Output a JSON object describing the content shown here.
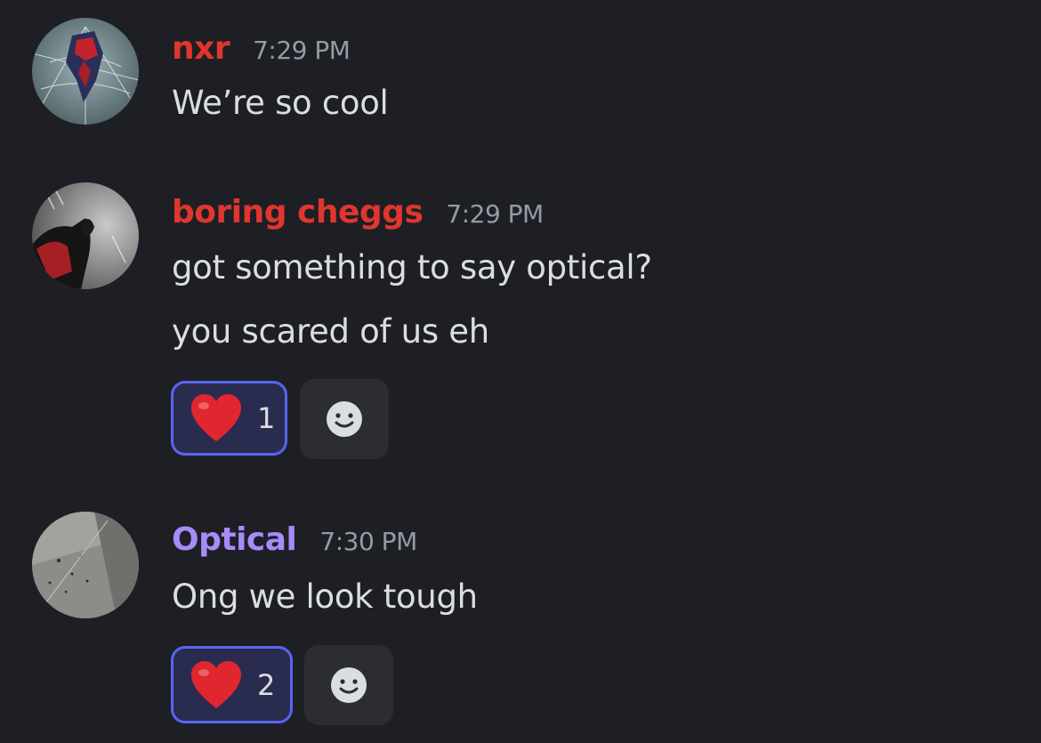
{
  "colors": {
    "background": "#1e1f24",
    "username_red": "#e0362e",
    "username_purple": "#a78bfa",
    "timestamp": "#949ba4",
    "message_text": "#dbdee1",
    "reaction_active_bg": "#2a2c4f",
    "reaction_active_border": "#5865f2",
    "add_reaction_bg": "#2b2d31"
  },
  "messages": [
    {
      "username": "nxr",
      "timestamp": "7:29 PM",
      "avatar_icon": "spiderman-avatar",
      "lines": [
        "We’re so cool"
      ]
    },
    {
      "username": "boring cheggs",
      "timestamp": "7:29 PM",
      "avatar_icon": "daredevil-avatar",
      "lines": [
        "got something to say optical?",
        "you scared of us eh"
      ],
      "reactions": [
        {
          "emoji": "heart-emoji",
          "count": "1"
        }
      ],
      "add_reaction_icon": "smiley-icon"
    },
    {
      "username": "Optical",
      "timestamp": "7:30 PM",
      "avatar_icon": "grey-wall-avatar",
      "lines": [
        "Ong we look tough"
      ],
      "reactions": [
        {
          "emoji": "heart-emoji",
          "count": "2"
        }
      ],
      "add_reaction_icon": "smiley-icon"
    }
  ]
}
